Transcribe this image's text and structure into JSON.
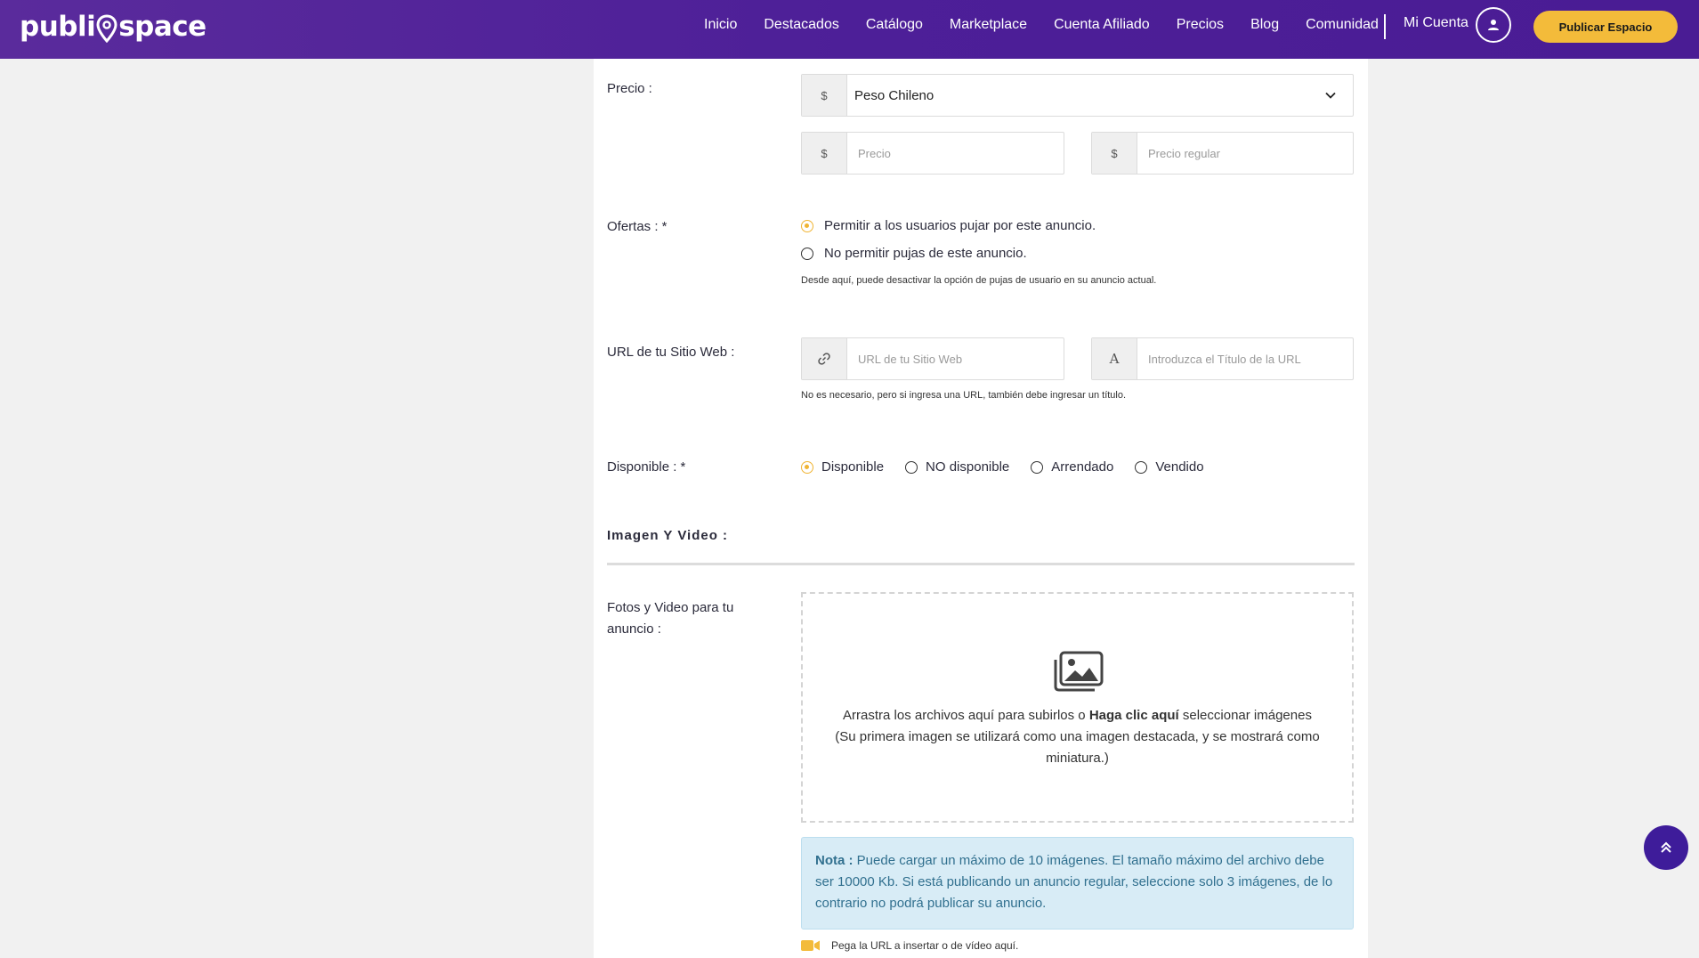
{
  "brand": {
    "logo_left": "publi",
    "logo_right": "space"
  },
  "nav": {
    "items": [
      "Inicio",
      "Destacados",
      "Catálogo",
      "Marketplace",
      "Cuenta Afiliado",
      "Precios",
      "Blog",
      "Comunidad"
    ],
    "account_label": "Mi Cuenta",
    "publish_button": "Publicar Espacio"
  },
  "form": {
    "price": {
      "label": "Precio :",
      "currency_symbol": "$",
      "currency_selected": "Peso Chileno",
      "price_placeholder": "Precio",
      "regular_price_placeholder": "Precio regular"
    },
    "offers": {
      "label": "Ofertas : *",
      "options": [
        "Permitir a los usuarios pujar por este anuncio.",
        "No permitir pujas de este anuncio."
      ],
      "selected_index": 0,
      "help": "Desde aquí, puede desactivar la opción de pujas de usuario en su anuncio actual."
    },
    "website": {
      "label": "URL de tu Sitio Web :",
      "url_placeholder": "URL de tu Sitio Web",
      "title_icon_glyph": "A",
      "title_placeholder": "Introduzca el Título de la URL",
      "help": "No es necesario, pero si ingresa una URL, también debe ingresar un título."
    },
    "availability": {
      "label": "Disponible : *",
      "options": [
        "Disponible",
        "NO disponible",
        "Arrendado",
        "Vendido"
      ],
      "selected_index": 0
    },
    "media": {
      "section_title": "Imagen Y Video :",
      "label": "Fotos y Video para tu anuncio :",
      "drop_text_before": "Arrastra los archivos aquí para subirlos o ",
      "drop_text_bold": "Haga clic aquí",
      "drop_text_after": " seleccionar imágenes",
      "drop_subtext": "(Su primera imagen se utilizará como una imagen destacada, y se mostrará como miniatura.)",
      "note_bold": "Nota :",
      "note_text": " Puede cargar un máximo de 10 imágenes. El tamaño máximo del archivo debe ser 10000 Kb. Si está publicando un anuncio regular, seleccione solo 3 imágenes, de lo contrario no podrá publicar su anuncio.",
      "video_hint": "Pega la URL a insertar o de vídeo aquí."
    }
  },
  "colors": {
    "nav_bg": "#4d1f98",
    "accent": "#f3bb3a",
    "note_bg": "#d8ecf6",
    "note_text": "#31708f",
    "fab_bg": "#3e1c9a"
  },
  "icons": {
    "dropdown": "chevron-down-icon",
    "link": "link-icon",
    "gallery": "images-icon",
    "video": "video-camera-icon",
    "scroll_top": "double-chevron-up-icon",
    "account": "user-icon"
  }
}
